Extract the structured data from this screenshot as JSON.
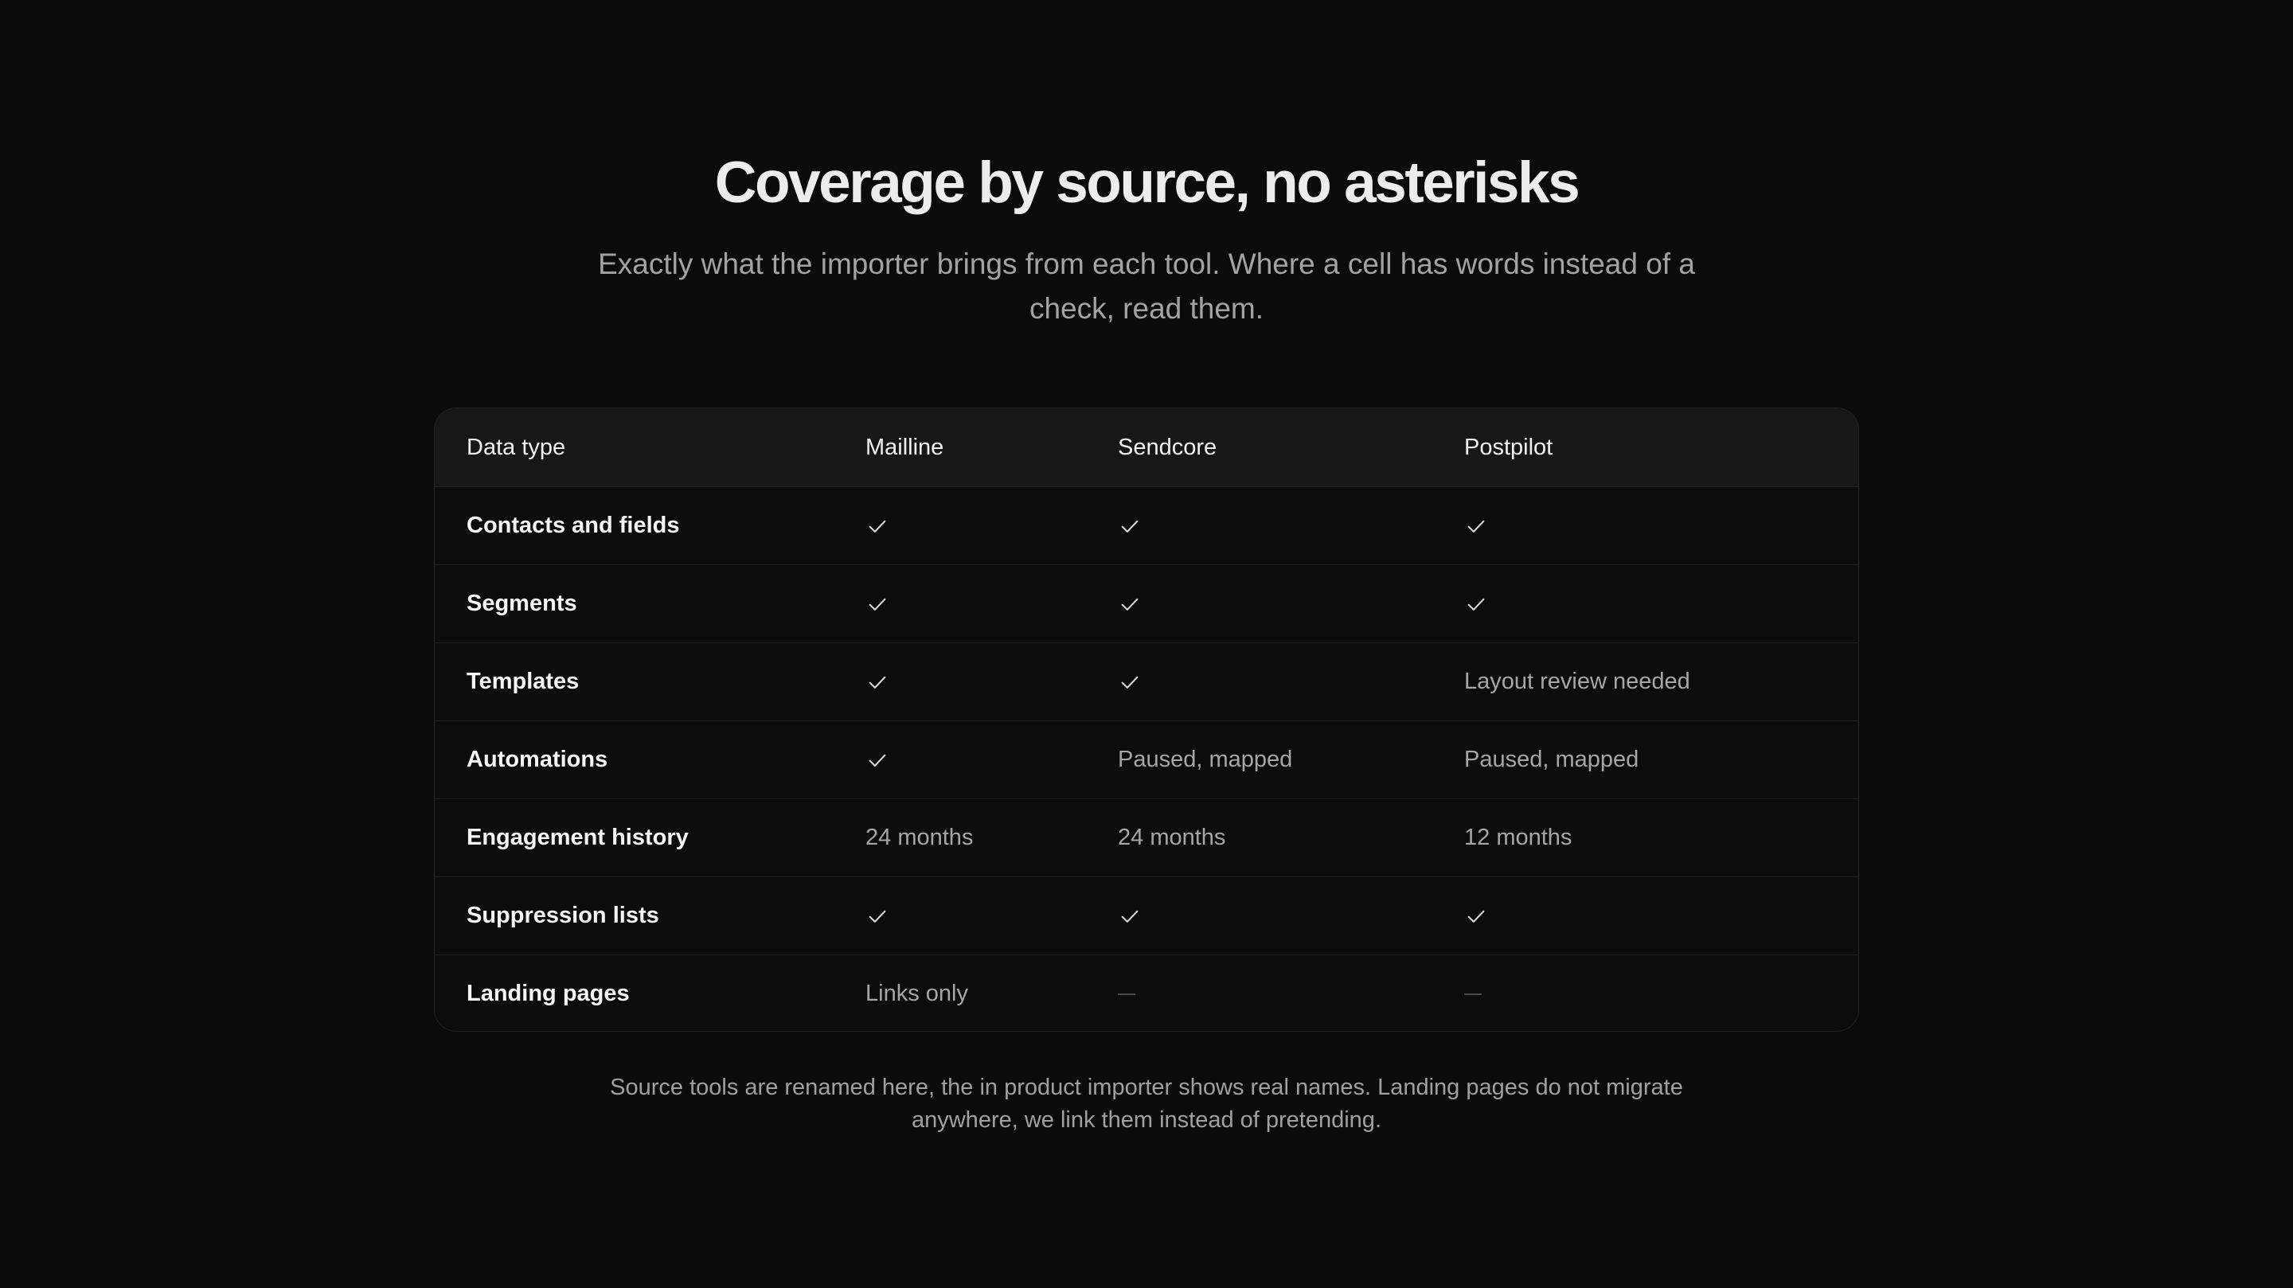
{
  "header": {
    "title": "Coverage by source, no asterisks",
    "subtitle": "Exactly what the importer brings from each tool. Where a cell has words instead of a check, read them."
  },
  "table": {
    "columns": [
      "Data type",
      "Mailline",
      "Sendcore",
      "Postpilot"
    ],
    "rows": [
      {
        "label": "Contacts and fields",
        "cells": [
          "check",
          "check",
          "check"
        ]
      },
      {
        "label": "Segments",
        "cells": [
          "check",
          "check",
          "check"
        ]
      },
      {
        "label": "Templates",
        "cells": [
          "check",
          "check",
          "Layout review needed"
        ]
      },
      {
        "label": "Automations",
        "cells": [
          "check",
          "Paused, mapped",
          "Paused, mapped"
        ]
      },
      {
        "label": "Engagement history",
        "cells": [
          "24 months",
          "24 months",
          "12 months"
        ]
      },
      {
        "label": "Suppression lists",
        "cells": [
          "check",
          "check",
          "check"
        ]
      },
      {
        "label": "Landing pages",
        "cells": [
          "Links only",
          "—",
          "—"
        ]
      }
    ]
  },
  "footnote": "Source tools are renamed here, the in product importer shows real names. Landing pages do not migrate anywhere, we link them instead of pretending.",
  "icons": {
    "check": "check-icon",
    "dash": "dash-icon"
  },
  "colors": {
    "background": "#0b0b0b",
    "header_row": "#171717",
    "muted_text": "#a6a6a6"
  }
}
